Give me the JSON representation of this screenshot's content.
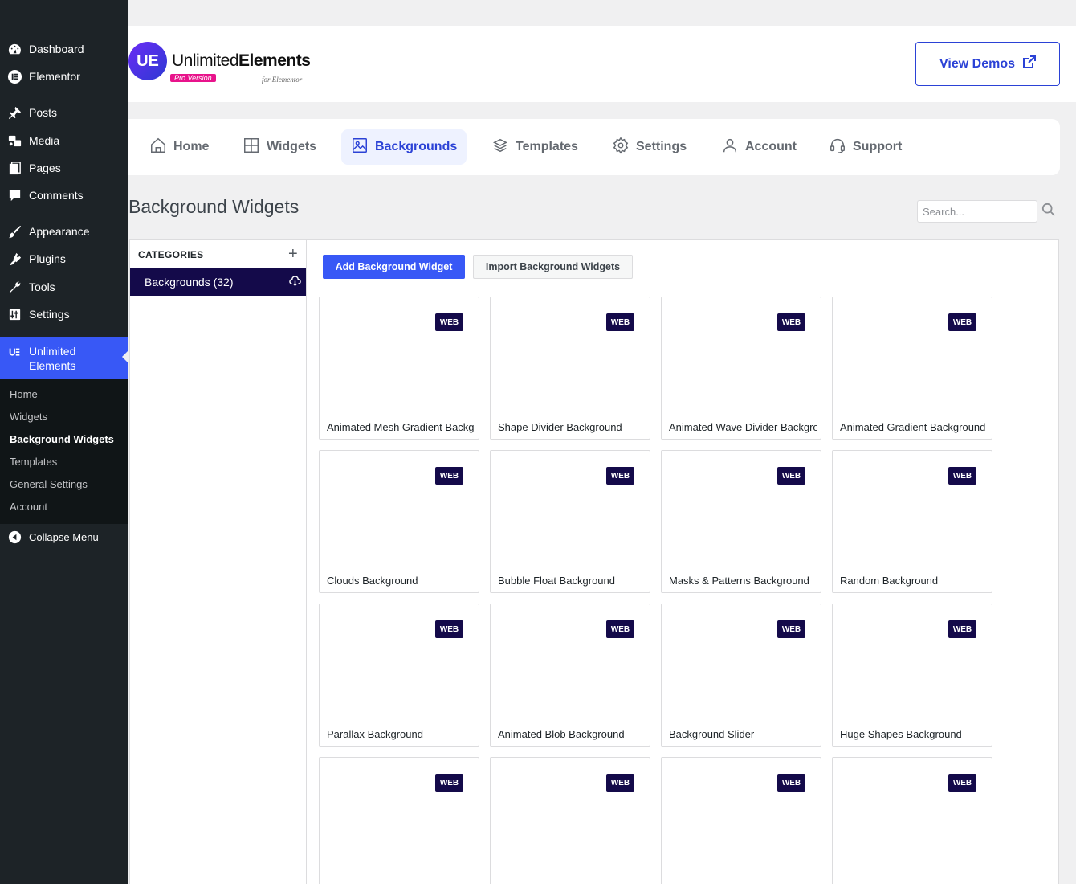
{
  "sidebar": {
    "items": [
      {
        "label": "Dashboard",
        "icon": "dashboard-icon"
      },
      {
        "label": "Elementor",
        "icon": "elementor-icon"
      },
      {
        "label": "Posts",
        "icon": "pin-icon"
      },
      {
        "label": "Media",
        "icon": "media-icon"
      },
      {
        "label": "Pages",
        "icon": "pages-icon"
      },
      {
        "label": "Comments",
        "icon": "comments-icon"
      },
      {
        "label": "Appearance",
        "icon": "brush-icon"
      },
      {
        "label": "Plugins",
        "icon": "plug-icon"
      },
      {
        "label": "Tools",
        "icon": "wrench-icon"
      },
      {
        "label": "Settings",
        "icon": "sliders-icon"
      }
    ],
    "active": {
      "label": "Unlimited Elements",
      "icon": "unlimited-elements-icon"
    },
    "submenu": [
      "Home",
      "Widgets",
      "Background Widgets",
      "Templates",
      "General Settings",
      "Account"
    ],
    "collapse_label": "Collapse Menu"
  },
  "header": {
    "logo_text_light": "Unlimited",
    "logo_text_bold": "Elements",
    "logo_badge": "Pro Version",
    "logo_sub": "for Elementor",
    "view_demos": "View Demos"
  },
  "tabs": [
    "Home",
    "Widgets",
    "Backgrounds",
    "Templates",
    "Settings",
    "Account",
    "Support"
  ],
  "page": {
    "title": "Background Widgets",
    "search_placeholder": "Search..."
  },
  "categories": {
    "heading": "CATEGORIES",
    "items": [
      "Backgrounds (32)"
    ]
  },
  "actions": {
    "add": "Add Background Widget",
    "import": "Import Background Widgets"
  },
  "widgets": [
    {
      "title": "Animated Mesh Gradient Background",
      "badge": "WEB"
    },
    {
      "title": "Shape Divider Background",
      "badge": "WEB"
    },
    {
      "title": "Animated Wave Divider Background",
      "badge": "WEB"
    },
    {
      "title": "Animated Gradient Background",
      "badge": "WEB"
    },
    {
      "title": "Clouds Background",
      "badge": "WEB"
    },
    {
      "title": "Bubble Float Background",
      "badge": "WEB"
    },
    {
      "title": "Masks & Patterns Background",
      "badge": "WEB"
    },
    {
      "title": "Random Background",
      "badge": "WEB"
    },
    {
      "title": "Parallax Background",
      "badge": "WEB"
    },
    {
      "title": "Animated Blob Background",
      "badge": "WEB"
    },
    {
      "title": "Background Slider",
      "badge": "WEB"
    },
    {
      "title": "Huge Shapes Background",
      "badge": "WEB"
    },
    {
      "title": "",
      "badge": "WEB"
    },
    {
      "title": "",
      "badge": "WEB"
    },
    {
      "title": "",
      "badge": "WEB"
    },
    {
      "title": "",
      "badge": "WEB"
    }
  ]
}
